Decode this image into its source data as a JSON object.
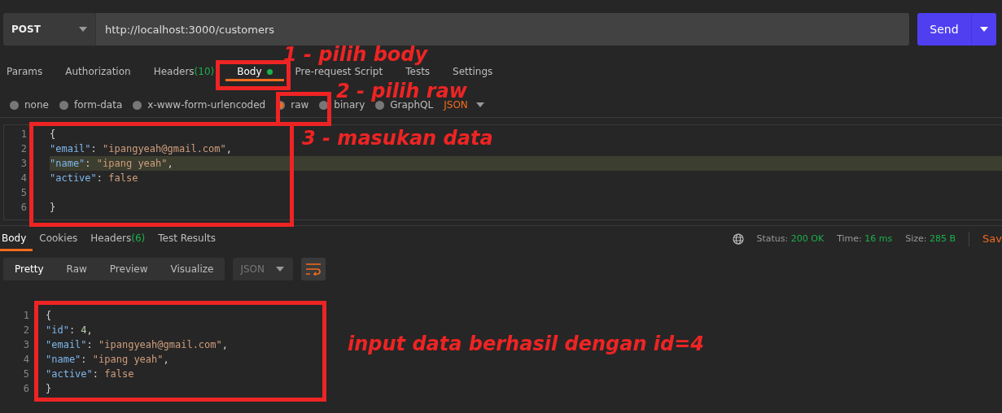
{
  "request": {
    "method": "POST",
    "url": "http://localhost:3000/customers",
    "send": "Send"
  },
  "request_tabs": [
    {
      "label": "Params",
      "selected": false
    },
    {
      "label": "Authorization",
      "selected": false
    },
    {
      "label": "Headers",
      "count": "(10)",
      "selected": false
    },
    {
      "label": "Body",
      "dot": true,
      "selected": true
    },
    {
      "label": "Pre-request Script",
      "selected": false
    },
    {
      "label": "Tests",
      "selected": false
    },
    {
      "label": "Settings",
      "selected": false
    }
  ],
  "body_types": [
    {
      "label": "none",
      "selected": false
    },
    {
      "label": "form-data",
      "selected": false
    },
    {
      "label": "x-www-form-urlencoded",
      "selected": false
    },
    {
      "label": "raw",
      "selected": true
    },
    {
      "label": "binary",
      "selected": false
    },
    {
      "label": "GraphQL",
      "selected": false
    }
  ],
  "body_format": "JSON",
  "request_editor": [
    {
      "number": "1",
      "tokens": [
        {
          "kind": "punct",
          "text": "{"
        }
      ]
    },
    {
      "number": "2",
      "tokens": [
        {
          "kind": "key",
          "text": "\"email\""
        },
        {
          "kind": "punct",
          "text": ": "
        },
        {
          "kind": "string",
          "text": "\"ipangyeah@gmail.com\""
        },
        {
          "kind": "punct",
          "text": ","
        }
      ]
    },
    {
      "number": "3",
      "highlighted": true,
      "tokens": [
        {
          "kind": "key",
          "text": "\"name\""
        },
        {
          "kind": "punct",
          "text": ": "
        },
        {
          "kind": "string",
          "text": "\"ipang yeah\""
        },
        {
          "kind": "punct",
          "text": ","
        }
      ]
    },
    {
      "number": "4",
      "tokens": [
        {
          "kind": "key",
          "text": "\"active\""
        },
        {
          "kind": "punct",
          "text": ": "
        },
        {
          "kind": "bool",
          "text": "false"
        }
      ]
    },
    {
      "number": "5"
    },
    {
      "number": "6",
      "tokens": [
        {
          "kind": "punct",
          "text": "}"
        }
      ]
    }
  ],
  "response_tabs": [
    {
      "label": "Body",
      "selected": true
    },
    {
      "label": "Cookies",
      "selected": false
    },
    {
      "label": "Headers",
      "count": "(6)",
      "selected": false
    },
    {
      "label": "Test Results",
      "selected": false
    }
  ],
  "response_status": [
    {
      "label": "Status:",
      "value": "200 OK"
    },
    {
      "label": "Time:",
      "value": "16 ms"
    },
    {
      "label": "Size:",
      "value": "285 B"
    }
  ],
  "save": "Sav",
  "view_modes": [
    {
      "label": "Pretty",
      "selected": true
    },
    {
      "label": "Raw",
      "selected": false
    },
    {
      "label": "Preview",
      "selected": false
    },
    {
      "label": "Visualize",
      "selected": false
    }
  ],
  "response_format": "JSON",
  "response_editor": [
    {
      "number": "1",
      "tokens": [
        {
          "kind": "punct",
          "text": "{"
        }
      ]
    },
    {
      "number": "2",
      "tokens": [
        {
          "kind": "key",
          "text": "\"id\""
        },
        {
          "kind": "punct",
          "text": ": "
        },
        {
          "kind": "number",
          "text": "4"
        },
        {
          "kind": "punct",
          "text": ","
        }
      ]
    },
    {
      "number": "3",
      "tokens": [
        {
          "kind": "key",
          "text": "\"email\""
        },
        {
          "kind": "punct",
          "text": ": "
        },
        {
          "kind": "string",
          "text": "\"ipangyeah@gmail.com\""
        },
        {
          "kind": "punct",
          "text": ","
        }
      ]
    },
    {
      "number": "4",
      "tokens": [
        {
          "kind": "key",
          "text": "\"name\""
        },
        {
          "kind": "punct",
          "text": ": "
        },
        {
          "kind": "string",
          "text": "\"ipang yeah\""
        },
        {
          "kind": "punct",
          "text": ","
        }
      ]
    },
    {
      "number": "5",
      "tokens": [
        {
          "kind": "key",
          "text": "\"active\""
        },
        {
          "kind": "punct",
          "text": ": "
        },
        {
          "kind": "bool",
          "text": "false"
        }
      ]
    },
    {
      "number": "6",
      "tokens": [
        {
          "kind": "punct",
          "text": "}"
        }
      ]
    }
  ],
  "annotations": [
    {
      "text": "1 - pilih body"
    },
    {
      "text": "2 - pilih raw"
    },
    {
      "text": "3 - masukan data"
    },
    {
      "text": "input data berhasil dengan id=4"
    }
  ]
}
